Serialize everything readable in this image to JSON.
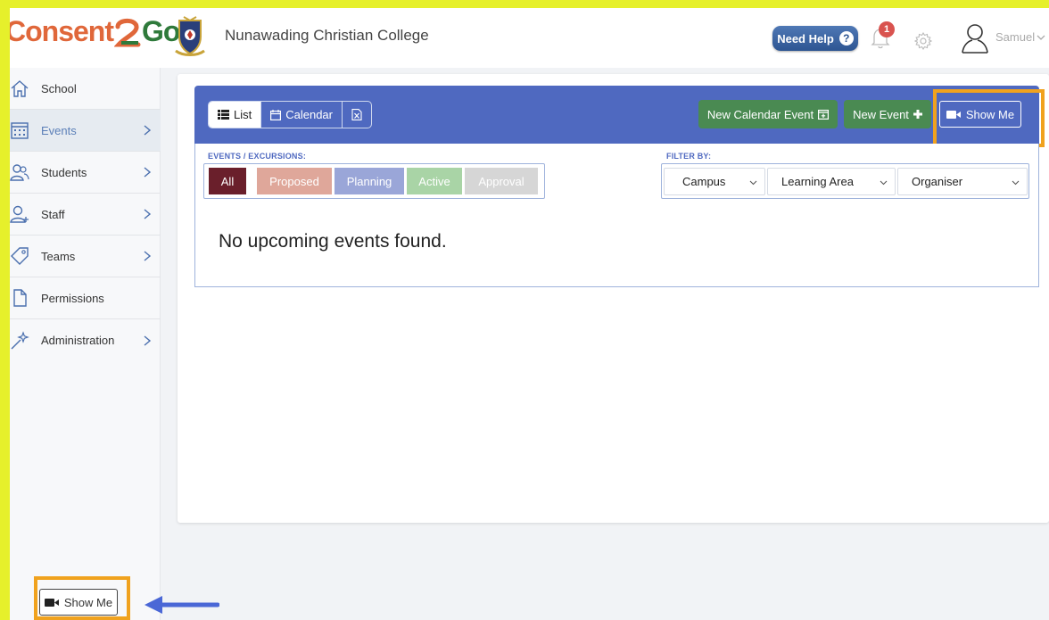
{
  "header": {
    "logo_left": "Consent",
    "logo_right": "Go",
    "college_name": "Nunawading Christian College",
    "need_help_label": "Need Help",
    "notification_count": "1",
    "user_name": "Samuel"
  },
  "sidebar": {
    "items": [
      {
        "label": "School",
        "icon": "home-icon",
        "has_chevron": false,
        "active": false
      },
      {
        "label": "Events",
        "icon": "calendar-icon",
        "has_chevron": true,
        "active": true
      },
      {
        "label": "Students",
        "icon": "students-icon",
        "has_chevron": true,
        "active": false
      },
      {
        "label": "Staff",
        "icon": "staff-icon",
        "has_chevron": true,
        "active": false
      },
      {
        "label": "Teams",
        "icon": "tag-icon",
        "has_chevron": true,
        "active": false
      },
      {
        "label": "Permissions",
        "icon": "document-icon",
        "has_chevron": false,
        "active": false
      },
      {
        "label": "Administration",
        "icon": "magic-wand-icon",
        "has_chevron": true,
        "active": false
      }
    ],
    "show_me_label": "Show Me"
  },
  "toolbar": {
    "view_list": "List",
    "view_calendar": "Calendar",
    "new_calendar_event": "New Calendar Event",
    "new_event": "New Event",
    "show_me": "Show Me"
  },
  "events": {
    "section_label": "EVENTS / EXCURSIONS:",
    "statuses": [
      {
        "label": "All",
        "color": "#6a1f2b"
      },
      {
        "label": "Proposed",
        "color": "#dfa79a"
      },
      {
        "label": "Planning",
        "color": "#9aa6d8"
      },
      {
        "label": "Active",
        "color": "#a9d4a6"
      },
      {
        "label": "Approval",
        "color": "#d6d6d6"
      }
    ],
    "empty_message": "No upcoming events found."
  },
  "filter": {
    "section_label": "FILTER BY:",
    "campus": "Campus",
    "learning_area": "Learning Area",
    "organiser": "Organiser"
  },
  "colors": {
    "toolbar_blue": "#4f69c0",
    "green_button": "#4a8a52",
    "annotation_orange": "#f0a21e",
    "annotation_yellow": "#e6f02b",
    "annotation_arrow_blue": "#4a67d6"
  }
}
